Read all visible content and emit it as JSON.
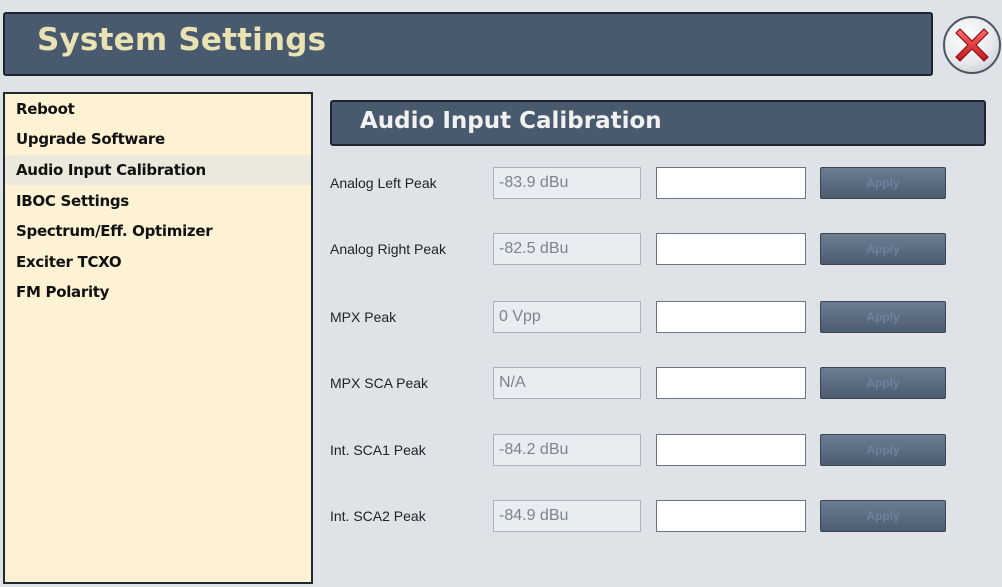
{
  "window": {
    "title": "System Settings",
    "close_icon": "close-x-icon"
  },
  "sidebar": {
    "items": [
      {
        "label": "Reboot",
        "selected": false
      },
      {
        "label": "Upgrade Software",
        "selected": false
      },
      {
        "label": "Audio Input Calibration",
        "selected": true
      },
      {
        "label": "IBOC Settings",
        "selected": false
      },
      {
        "label": "Spectrum/Eff. Optimizer",
        "selected": false
      },
      {
        "label": "Exciter TCXO",
        "selected": false
      },
      {
        "label": "FM Polarity",
        "selected": false
      }
    ]
  },
  "main": {
    "header": "Audio Input Calibration",
    "rows": [
      {
        "label": "Analog Left Peak",
        "value": "-83.9 dBu",
        "input": "",
        "button": "Apply"
      },
      {
        "label": "Analog Right Peak",
        "value": "-82.5 dBu",
        "input": "",
        "button": "Apply"
      },
      {
        "label": "MPX Peak",
        "value": "0 Vpp",
        "input": "",
        "button": "Apply"
      },
      {
        "label": "MPX SCA Peak",
        "value": "N/A",
        "input": "",
        "button": "Apply"
      },
      {
        "label": "Int. SCA1 Peak",
        "value": "-84.2 dBu",
        "input": "",
        "button": "Apply"
      },
      {
        "label": "Int. SCA2 Peak",
        "value": "-84.9 dBu",
        "input": "",
        "button": "Apply"
      }
    ]
  },
  "colors": {
    "titlebar": "#4a5a6e",
    "title_text": "#e9e2b3",
    "sidebar_bg": "#fdf3d4",
    "close_red": "#e0343a"
  }
}
